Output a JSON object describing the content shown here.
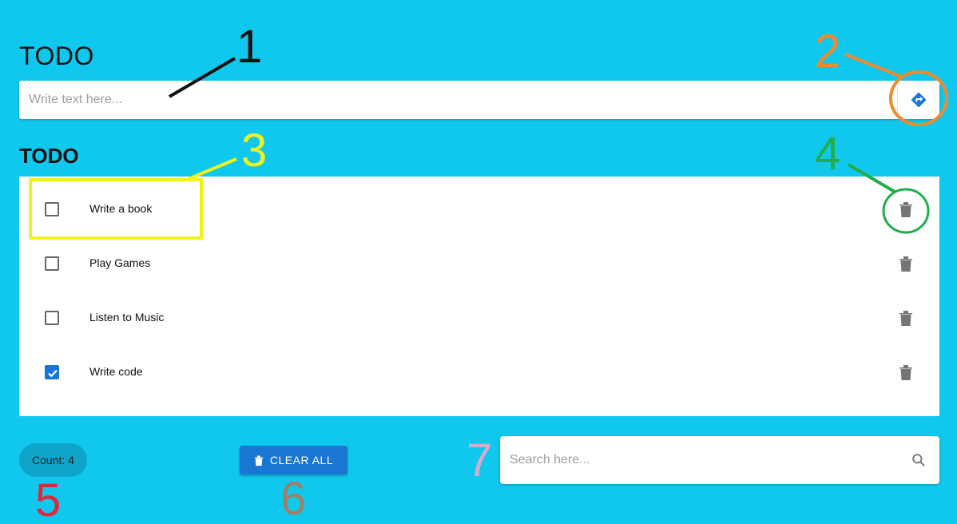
{
  "app": {
    "title": "TODO"
  },
  "add_bar": {
    "placeholder": "Write text here...",
    "submit_icon": "directions-icon"
  },
  "list": {
    "title": "TODO",
    "items": [
      {
        "label": "Write a book",
        "checked": false
      },
      {
        "label": "Play Games",
        "checked": false
      },
      {
        "label": "Listen to Music",
        "checked": false
      },
      {
        "label": "Write code",
        "checked": true
      }
    ],
    "delete_icon": "trash-icon"
  },
  "footer": {
    "count_label": "Count: 4",
    "clear_all_label": "CLEAR ALL",
    "search_placeholder": "Search here..."
  },
  "annotations": [
    {
      "label": "1",
      "color": "#111111"
    },
    {
      "label": "2",
      "color": "#f08a2c"
    },
    {
      "label": "3",
      "color": "#f2f21a"
    },
    {
      "label": "4",
      "color": "#1fae4a"
    },
    {
      "label": "5",
      "color": "#e0283a"
    },
    {
      "label": "6",
      "color": "#a08060"
    },
    {
      "label": "7",
      "color": "#e0a8c8"
    }
  ],
  "colors": {
    "background": "#10c8ee",
    "accent": "#1976d2"
  }
}
